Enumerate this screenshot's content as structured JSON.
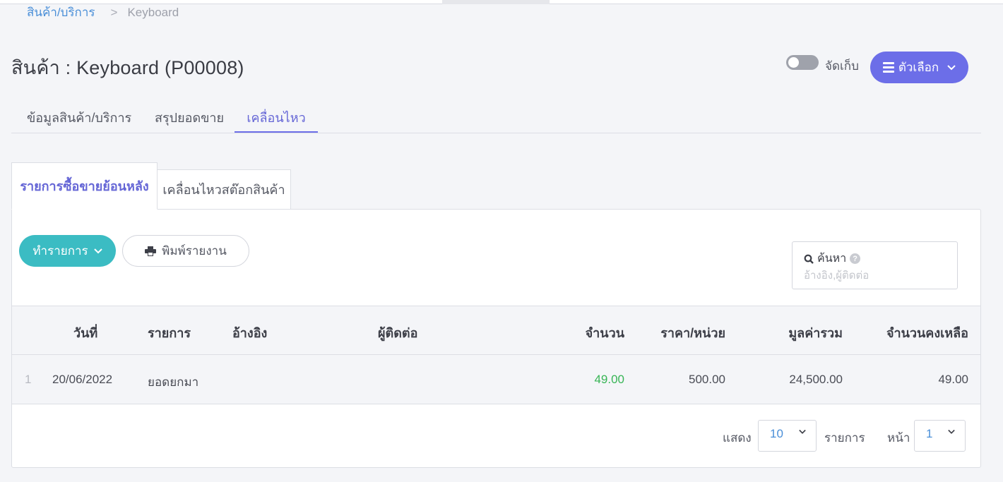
{
  "breadcrumb": {
    "parent": "สินค้า/บริการ",
    "separator": ">",
    "current": "Keyboard"
  },
  "page_title": "สินค้า : Keyboard (P00008)",
  "header": {
    "archive_label": "จัดเก็บ",
    "archive_on": false,
    "options_label": "ตัวเลือก"
  },
  "main_tabs": [
    {
      "label": "ข้อมูลสินค้า/บริการ",
      "active": false
    },
    {
      "label": "สรุปยอดขาย",
      "active": false
    },
    {
      "label": "เคลื่อนไหว",
      "active": true
    }
  ],
  "sub_tabs": [
    {
      "label": "รายการซื้อขายย้อนหลัง",
      "active": true
    },
    {
      "label": "เคลื่อนไหวสต๊อกสินค้า",
      "active": false
    }
  ],
  "toolbar": {
    "action_label": "ทำรายการ",
    "print_label": "พิมพ์รายงาน"
  },
  "search": {
    "label": "ค้นหา",
    "help": "?",
    "placeholder": "อ้างอิง,ผู้ติดต่อ",
    "value": ""
  },
  "table": {
    "columns": [
      "วันที่",
      "รายการ",
      "อ้างอิง",
      "ผู้ติดต่อ",
      "จำนวน",
      "ราคา/หน่วย",
      "มูลค่ารวม",
      "จำนวนคงเหลือ"
    ],
    "rows": [
      {
        "no": "1",
        "date": "20/06/2022",
        "item": "ยอดยกมา",
        "reference": "",
        "contact": "",
        "quantity": "49.00",
        "unit_price": "500.00",
        "total": "24,500.00",
        "balance": "49.00"
      }
    ]
  },
  "pagination": {
    "show_label": "แสดง",
    "page_size": "10",
    "items_label": "รายการ",
    "page_label": "หน้า",
    "page": "1"
  },
  "colors": {
    "primary": "#6c6ee8",
    "teal": "#3bbcc3",
    "link": "#4a8fd8",
    "positive": "#38b556"
  }
}
